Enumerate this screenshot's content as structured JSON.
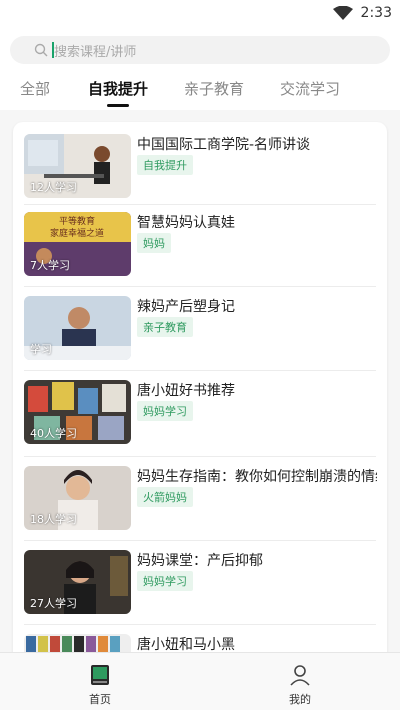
{
  "status_bar": {
    "time": "2:33"
  },
  "search": {
    "placeholder": "搜索课程/讲师"
  },
  "tabs": [
    {
      "label": "全部",
      "active": false
    },
    {
      "label": "自我提升",
      "active": true
    },
    {
      "label": "亲子教育",
      "active": false
    },
    {
      "label": "交流学习",
      "active": false
    }
  ],
  "courses": [
    {
      "title": "中国国际工商学院-名师讲谈",
      "tag": "自我提升",
      "count": "12人学习"
    },
    {
      "title": "智慧妈妈认真娃",
      "tag": "妈妈",
      "count": "7人学习",
      "thumb_text": [
        "平等教育",
        "家庭幸福之道"
      ]
    },
    {
      "title": "辣妈产后塑身记",
      "tag": "亲子教育",
      "count": "学习"
    },
    {
      "title": "唐小妞好书推荐",
      "tag": "妈妈学习",
      "count": "40人学习"
    },
    {
      "title": "妈妈生存指南：教你如何控制崩溃的情绪",
      "tag": "火箭妈妈",
      "count": "18人学习"
    },
    {
      "title": "妈妈课堂：产后抑郁",
      "tag": "妈妈学习",
      "count": "27人学习"
    },
    {
      "title": "唐小妞和马小黑",
      "tag": "",
      "count": ""
    }
  ],
  "bottom_nav": [
    {
      "label": "首页",
      "icon": "book-icon",
      "active": true
    },
    {
      "label": "我的",
      "icon": "user-icon",
      "active": false
    }
  ],
  "colors": {
    "accent": "#2e9a5f",
    "tag_bg": "#e8f5ed"
  }
}
